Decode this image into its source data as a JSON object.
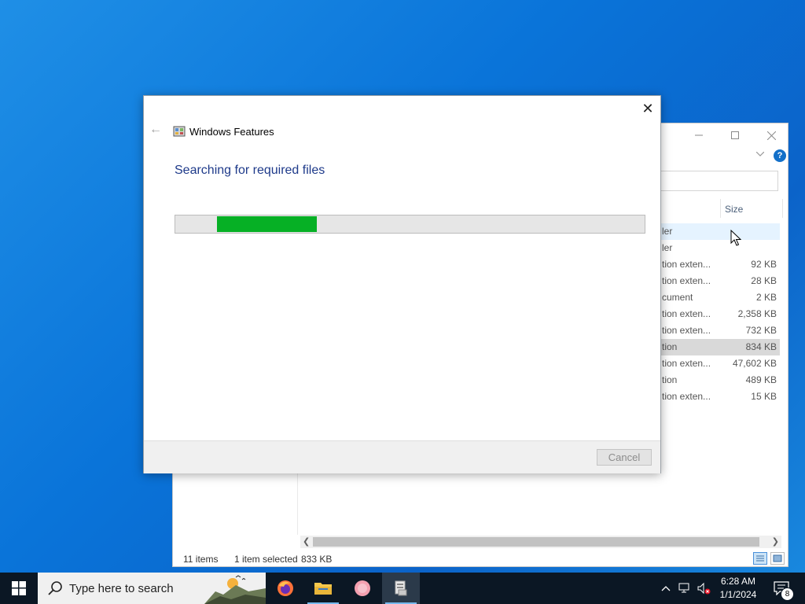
{
  "dialog": {
    "app_title": "Windows Features",
    "heading": "Searching for required files",
    "progress": {
      "start": 0.088,
      "end": 0.3
    },
    "cancel_label": "Cancel",
    "close_glyph": "✕",
    "back_glyph": "←"
  },
  "explorer": {
    "column_size_label": "Size",
    "rows": [
      {
        "type": "ler",
        "size": ""
      },
      {
        "type": "ler",
        "size": ""
      },
      {
        "type": "tion exten...",
        "size": "92 KB"
      },
      {
        "type": "tion exten...",
        "size": "28 KB"
      },
      {
        "type": "cument",
        "size": "2 KB"
      },
      {
        "type": "tion exten...",
        "size": "2,358 KB"
      },
      {
        "type": "tion exten...",
        "size": "732 KB"
      },
      {
        "type": "tion",
        "size": "834 KB"
      },
      {
        "type": "tion exten...",
        "size": "47,602 KB"
      },
      {
        "type": "tion",
        "size": "489 KB"
      },
      {
        "type": "tion exten...",
        "size": "15 KB"
      }
    ],
    "status": {
      "items": "11 items",
      "selected": "1 item selected",
      "selected_size": "833 KB"
    }
  },
  "taskbar": {
    "search_placeholder": "Type here to search",
    "time": "6:28 AM",
    "date": "1/1/2024",
    "notification_count": "8",
    "apps": [
      "firefox-icon",
      "file-explorer-icon",
      "app-pink-icon",
      "windows-features-icon"
    ]
  },
  "colors": {
    "progress_fill": "#06b025",
    "heading": "#1e3a8a",
    "desktop": "#0a74d9",
    "taskbar": "#0b1724"
  }
}
